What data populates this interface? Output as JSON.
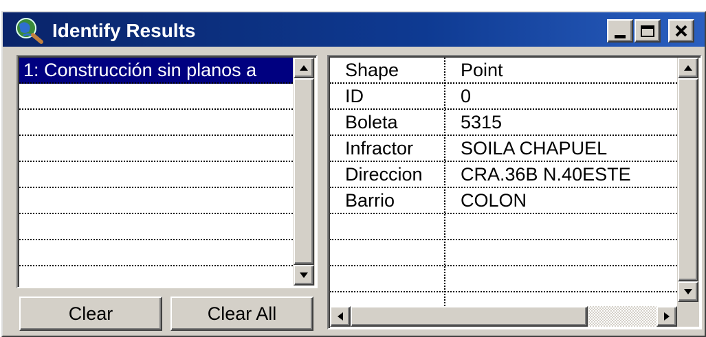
{
  "window": {
    "title": "Identify Results",
    "icon": "globe-magnifier-icon",
    "controls": [
      "minimize-icon",
      "maximize-icon",
      "close-icon"
    ]
  },
  "results_list": {
    "items": [
      "1:  Construcción sin planos a"
    ],
    "selected_index": 0
  },
  "attributes": {
    "rows": [
      {
        "field": "Shape",
        "value": "Point"
      },
      {
        "field": "ID",
        "value": "0"
      },
      {
        "field": "Boleta",
        "value": "5315"
      },
      {
        "field": "Infractor",
        "value": "SOILA CHAPUEL"
      },
      {
        "field": "Direccion",
        "value": "CRA.36B N.40ESTE"
      },
      {
        "field": "Barrio",
        "value": "COLON"
      }
    ]
  },
  "buttons": {
    "clear_label": "Clear",
    "clear_all_label": "Clear All"
  },
  "colors": {
    "titlebar": "#0a246a",
    "selection": "#000080",
    "face": "#d4d0c8"
  }
}
